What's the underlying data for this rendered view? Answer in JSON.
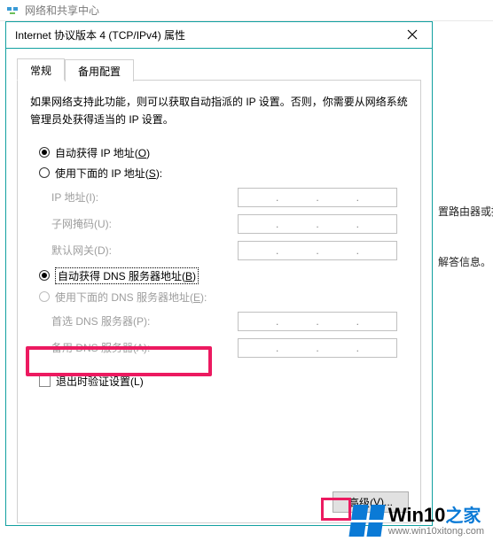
{
  "parent": {
    "title": "网络和共享中心",
    "line1": "置路由器或接",
    "line2": "解答信息。"
  },
  "dialog": {
    "title": "Internet 协议版本 4 (TCP/IPv4) 属性",
    "tabs": {
      "general": "常规",
      "alternate": "备用配置"
    },
    "description": "如果网络支持此功能，则可以获取自动指派的 IP 设置。否则，你需要从网络系统管理员处获得适当的 IP 设置。",
    "ip_group": {
      "auto_label": "自动获得 IP 地址(",
      "auto_key": "O",
      "auto_tail": ")",
      "manual_label": "使用下面的 IP 地址(",
      "manual_key": "S",
      "manual_tail": "):",
      "fields": {
        "ip": "IP 地址(",
        "ip_key": "I",
        "ip_tail": "):",
        "mask": "子网掩码(",
        "mask_key": "U",
        "mask_tail": "):",
        "gw": "默认网关(",
        "gw_key": "D",
        "gw_tail": "):"
      }
    },
    "dns_group": {
      "auto_label": "自动获得 DNS 服务器地址(",
      "auto_key": "B",
      "auto_tail": ")",
      "manual_label": "使用下面的 DNS 服务器地址(",
      "manual_key": "E",
      "manual_tail": "):",
      "fields": {
        "pref": "首选 DNS 服务器(",
        "pref_key": "P",
        "pref_tail": "):",
        "alt": "备用 DNS 服务器(",
        "alt_key": "A",
        "alt_tail": "):"
      }
    },
    "validate": {
      "label": "退出时验证设置(",
      "key": "L",
      "tail": ")"
    },
    "advanced": "高级(",
    "advanced_key": "V",
    "advanced_tail": ")..."
  },
  "watermark": {
    "brand": "Win10",
    "zhi": "之家",
    "url": "www.win10xitong.com"
  }
}
